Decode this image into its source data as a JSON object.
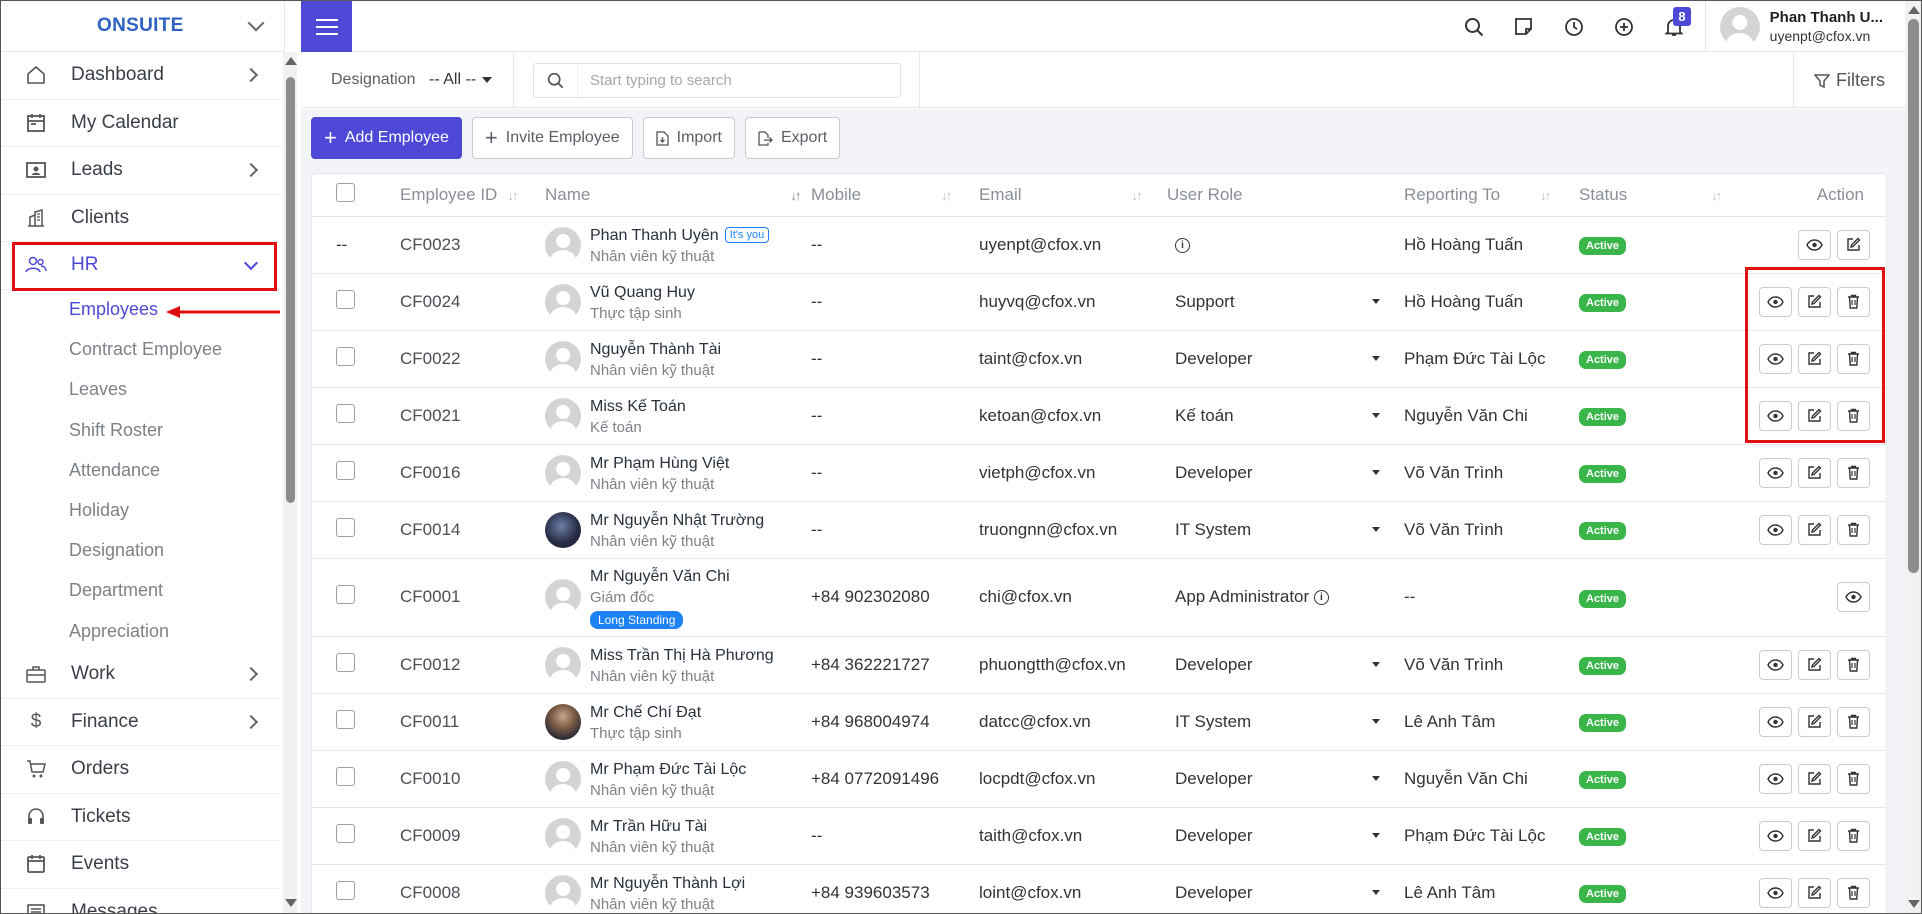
{
  "brand": {
    "name": "ONSUITE"
  },
  "sidebar": {
    "items": [
      {
        "label": "Dashboard",
        "icon": "house-icon",
        "chevron": true
      },
      {
        "label": "My Calendar",
        "icon": "calendar-icon",
        "chevron": false
      },
      {
        "label": "Leads",
        "icon": "contact-card-icon",
        "chevron": true
      },
      {
        "label": "Clients",
        "icon": "building-icon",
        "chevron": false
      },
      {
        "label": "HR",
        "icon": "people-icon",
        "chevron": true,
        "active": true
      }
    ],
    "hr_sub": [
      {
        "label": "Employees",
        "active": true
      },
      {
        "label": "Contract Employee"
      },
      {
        "label": "Leaves"
      },
      {
        "label": "Shift Roster"
      },
      {
        "label": "Attendance"
      },
      {
        "label": "Holiday"
      },
      {
        "label": "Designation"
      },
      {
        "label": "Department"
      },
      {
        "label": "Appreciation"
      }
    ],
    "items_after": [
      {
        "label": "Work",
        "icon": "briefcase-icon",
        "chevron": true
      },
      {
        "label": "Finance",
        "icon": "dollar-icon",
        "chevron": true
      },
      {
        "label": "Orders",
        "icon": "cart-icon",
        "chevron": false
      },
      {
        "label": "Tickets",
        "icon": "headset-icon",
        "chevron": false
      },
      {
        "label": "Events",
        "icon": "calendar-event-icon",
        "chevron": false
      },
      {
        "label": "Messages",
        "icon": "message-icon",
        "chevron": false
      }
    ]
  },
  "topbar": {
    "notification_count": "8",
    "user_name": "Phan Thanh U...",
    "user_email": "uyenpt@cfox.vn"
  },
  "filters": {
    "designation_label": "Designation",
    "designation_value": "-- All --",
    "search_placeholder": "Start typing to search",
    "filters_label": "Filters"
  },
  "actions": {
    "add": "Add Employee",
    "invite": "Invite Employee",
    "import": "Import",
    "export": "Export"
  },
  "table": {
    "headers": [
      "Employee ID",
      "Name",
      "Mobile",
      "Email",
      "User Role",
      "Reporting To",
      "Status",
      "Action"
    ],
    "rows": [
      {
        "id": "CF0023",
        "name": "Phan Thanh Uyên",
        "tag": "It's you",
        "title": "Nhân viên kỹ thuật",
        "mobile": "--",
        "email": "uyenpt@cfox.vn",
        "role": "",
        "role_info": true,
        "reporting": "Hồ Hoàng Tuấn",
        "status": "Active",
        "checkbox": false,
        "first_col": "--",
        "buttons": [
          "view",
          "edit"
        ]
      },
      {
        "id": "CF0024",
        "name": "Vũ Quang Huy",
        "title": "Thực tập sinh",
        "mobile": "--",
        "email": "huyvq@cfox.vn",
        "role": "Support",
        "reporting": "Hồ Hoàng Tuấn",
        "status": "Active",
        "buttons": [
          "view",
          "edit",
          "delete"
        ]
      },
      {
        "id": "CF0022",
        "name": "Nguyễn Thành Tài",
        "title": "Nhân viên kỹ thuật",
        "mobile": "--",
        "email": "taint@cfox.vn",
        "role": "Developer",
        "reporting": "Phạm Đức Tài Lộc",
        "status": "Active",
        "buttons": [
          "view",
          "edit",
          "delete"
        ]
      },
      {
        "id": "CF0021",
        "name": "Miss Kế Toán",
        "title": "Kế toán",
        "mobile": "--",
        "email": "ketoan@cfox.vn",
        "role": "Kế toán",
        "reporting": "Nguyễn Văn Chi",
        "status": "Active",
        "buttons": [
          "view",
          "edit",
          "delete"
        ]
      },
      {
        "id": "CF0016",
        "name": "Mr Phạm Hùng Việt",
        "title": "Nhân viên kỹ thuật",
        "mobile": "--",
        "email": "vietph@cfox.vn",
        "role": "Developer",
        "reporting": "Võ Văn Trình",
        "status": "Active",
        "buttons": [
          "view",
          "edit",
          "delete"
        ]
      },
      {
        "id": "CF0014",
        "name": "Mr Nguyễn Nhật Trường",
        "title": "Nhân viên kỹ thuật",
        "mobile": "--",
        "email": "truongnn@cfox.vn",
        "role": "IT System",
        "reporting": "Võ Văn Trình",
        "status": "Active",
        "photo": "photo",
        "buttons": [
          "view",
          "edit",
          "delete"
        ]
      },
      {
        "id": "CF0001",
        "name": "Mr Nguyễn Văn Chi",
        "title": "Giám đốc",
        "badge": "Long Standing",
        "mobile": "+84 902302080",
        "email": "chi@cfox.vn",
        "role": "App Administrator",
        "role_info": true,
        "reporting": "--",
        "status": "Active",
        "buttons": [
          "view"
        ]
      },
      {
        "id": "CF0012",
        "name": "Miss Trần Thị Hà Phương",
        "title": "Nhân viên kỹ thuật",
        "mobile": "+84 362221727",
        "email": "phuongtth@cfox.vn",
        "role": "Developer",
        "reporting": "Võ Văn Trình",
        "status": "Active",
        "buttons": [
          "view",
          "edit",
          "delete"
        ]
      },
      {
        "id": "CF0011",
        "name": "Mr Chế Chí Đạt",
        "title": "Thực tập sinh",
        "mobile": "+84 968004974",
        "email": "datcc@cfox.vn",
        "role": "IT System",
        "reporting": "Lê Anh Tâm",
        "status": "Active",
        "photo": "photo2",
        "buttons": [
          "view",
          "edit",
          "delete"
        ]
      },
      {
        "id": "CF0010",
        "name": "Mr Phạm Đức Tài Lộc",
        "title": "Nhân viên kỹ thuật",
        "mobile": "+84 0772091496",
        "email": "locpdt@cfox.vn",
        "role": "Developer",
        "reporting": "Nguyễn Văn Chi",
        "status": "Active",
        "buttons": [
          "view",
          "edit",
          "delete"
        ]
      },
      {
        "id": "CF0009",
        "name": "Mr Trần Hữu Tài",
        "title": "Nhân viên kỹ thuật",
        "mobile": "--",
        "email": "taith@cfox.vn",
        "role": "Developer",
        "reporting": "Phạm Đức Tài Lộc",
        "status": "Active",
        "buttons": [
          "view",
          "edit",
          "delete"
        ]
      },
      {
        "id": "CF0008",
        "name": "Mr Nguyễn Thành Lợi",
        "title": "Nhân viên kỹ thuật",
        "mobile": "+84 939603573",
        "email": "loint@cfox.vn",
        "role": "Developer",
        "reporting": "Lê Anh Tâm",
        "status": "Active",
        "buttons": [
          "view",
          "edit",
          "delete"
        ]
      }
    ]
  },
  "colors": {
    "accent": "#4d49d6",
    "active_status": "#39b54a",
    "highlight": "#e01010"
  }
}
